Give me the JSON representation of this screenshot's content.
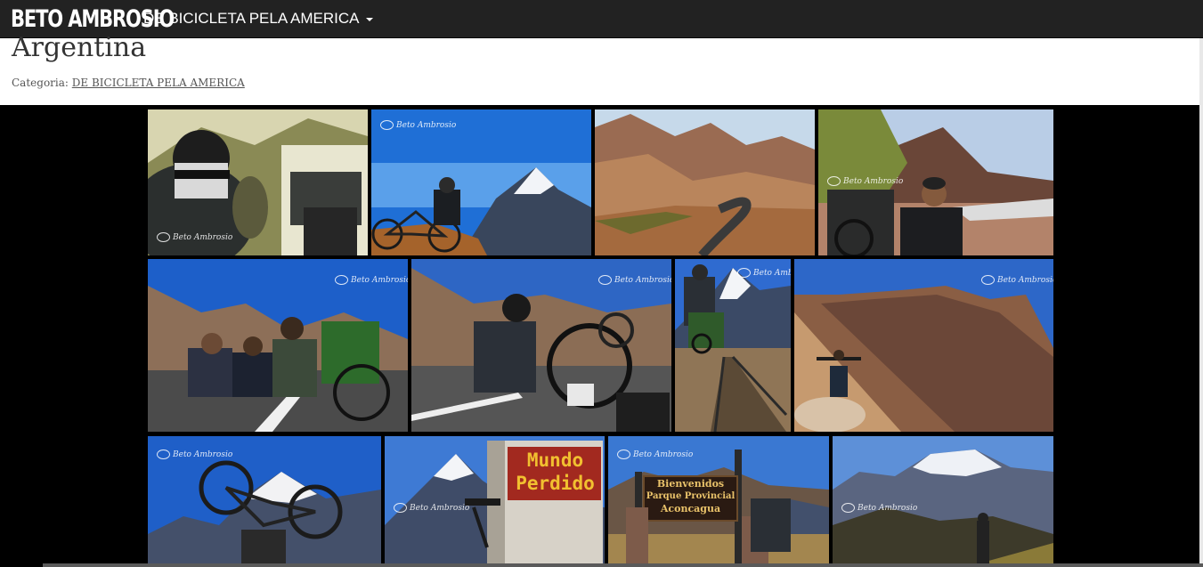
{
  "navbar": {
    "brand": "BETO AMBROSIO",
    "menu_label": "DE BICICLETA PELA AMERICA",
    "menu_icon": "caret-down-icon"
  },
  "post": {
    "title": "Argentina",
    "category_label": "Categoria:",
    "category_link": "DE BICICLETA PELA AMERICA"
  },
  "gallery": {
    "watermark": "Beto Ambrosio",
    "signs": {
      "mundo_line1": "Mundo",
      "mundo_line2": "Perdido",
      "park_line1": "Bienvenidos",
      "park_line2": "Parque Provincial",
      "park_line3": "Aconcagua"
    }
  },
  "colors": {
    "navbar_bg": "#222222",
    "gallery_bg": "#000000",
    "sky_blue": "#1f6fd6"
  }
}
